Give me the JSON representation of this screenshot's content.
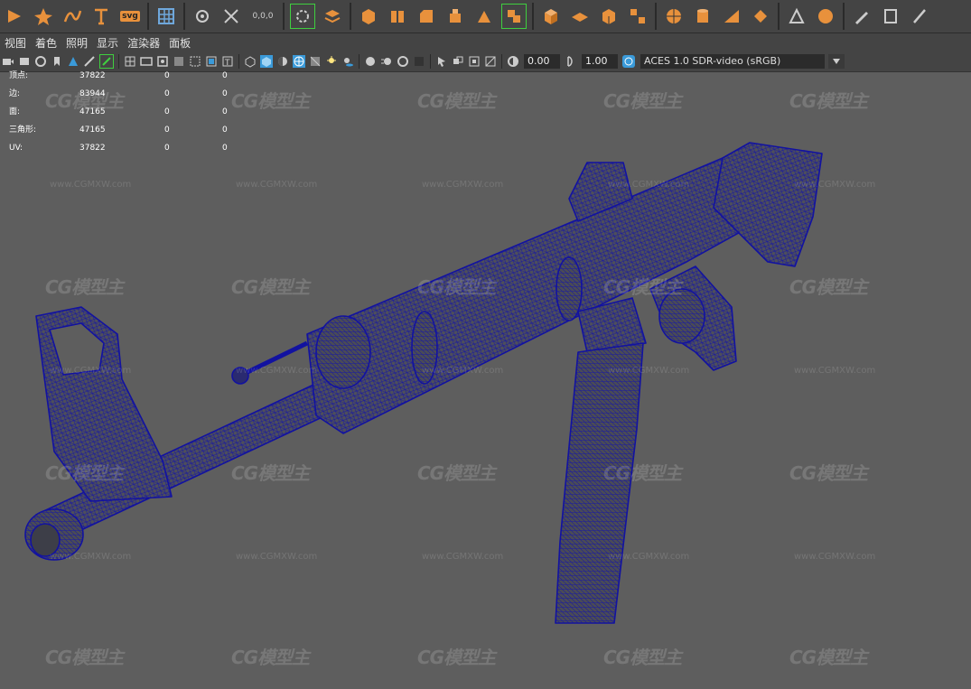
{
  "menu": [
    "视图",
    "着色",
    "照明",
    "显示",
    "渲染器",
    "面板"
  ],
  "shelf": {
    "svg_label": "svg",
    "coords_label": "0,0,0"
  },
  "viewport_toolbar": {
    "exposure": "0.00",
    "gamma": "1.00",
    "color_space": "ACES 1.0 SDR-video (sRGB)"
  },
  "hud": [
    {
      "label": "顶点:",
      "v1": "37822",
      "v2": "0",
      "v3": "0"
    },
    {
      "label": "边:",
      "v1": "83944",
      "v2": "0",
      "v3": "0"
    },
    {
      "label": "面:",
      "v1": "47165",
      "v2": "0",
      "v3": "0"
    },
    {
      "label": "三角形:",
      "v1": "47165",
      "v2": "0",
      "v3": "0"
    },
    {
      "label": "UV:",
      "v1": "37822",
      "v2": "0",
      "v3": "0"
    }
  ],
  "watermark": {
    "logo": "CG模型主",
    "url": "www.CGMXW.com"
  },
  "colors": {
    "viewport_bg": "#5e5e5e",
    "wireframe": "#1a1aa0",
    "shelf_accent": "#e8913c",
    "active_green": "#3fcf3f"
  },
  "icons": [
    "orange-shelf-icons",
    "camera-icon",
    "grid-icon",
    "wireframe-icon",
    "shaded-icon",
    "exposure-icon",
    "gamma-icon",
    "color-management-icon"
  ]
}
